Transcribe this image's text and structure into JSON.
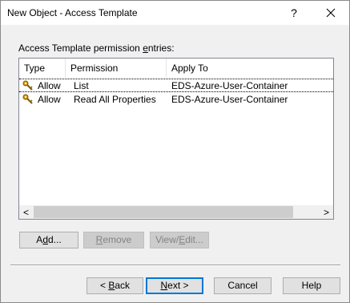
{
  "window": {
    "title": "New Object - Access Template",
    "help_glyph": "?",
    "close_glyph": "✕"
  },
  "list": {
    "label": "Access Template permission entries:",
    "columns": [
      "Type",
      "Permission",
      "Apply To"
    ],
    "rows": [
      {
        "icon": "key-icon",
        "type": "Allow",
        "permission": "List",
        "apply_to": "EDS-Azure-User-Container"
      },
      {
        "icon": "key-icon",
        "type": "Allow",
        "permission": "Read All Properties",
        "apply_to": "EDS-Azure-User-Container"
      }
    ],
    "scroll_left_glyph": "<",
    "scroll_right_glyph": ">"
  },
  "actions": {
    "add": "Add...",
    "remove": "Remove",
    "view_edit": "View/Edit..."
  },
  "footer": {
    "back": "< Back",
    "next": "Next >",
    "cancel": "Cancel",
    "help": "Help"
  }
}
